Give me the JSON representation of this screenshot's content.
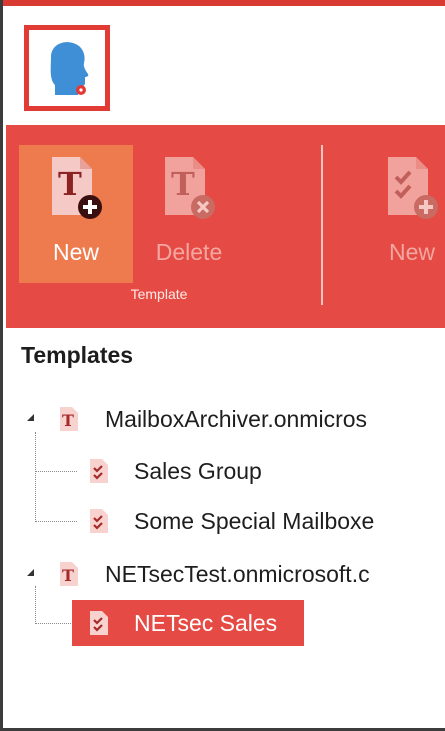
{
  "colors": {
    "ribbon": "#e54b44",
    "ribbon_active": "#ee7b4e",
    "selection": "#e54b44",
    "logo_border": "#e23a34",
    "logo_head": "#3f8fd7"
  },
  "ribbon": {
    "buttons": [
      {
        "label": "New",
        "icon": "template-new-icon",
        "state": "active"
      },
      {
        "label": "Delete",
        "icon": "template-delete-icon",
        "state": "disabled"
      },
      {
        "label": "New",
        "icon": "checklist-new-icon",
        "state": "disabled"
      }
    ],
    "group_label": "Template"
  },
  "tree": {
    "title": "Templates",
    "nodes": [
      {
        "label": "MailboxArchiver.onmicros",
        "icon": "template-t-icon",
        "level": 0,
        "expanded": true
      },
      {
        "label": "Sales Group",
        "icon": "checklist-doc-icon",
        "level": 1
      },
      {
        "label": "Some Special Mailboxe",
        "icon": "checklist-doc-icon",
        "level": 1
      },
      {
        "label": "NETsecTest.onmicrosoft.c",
        "icon": "template-t-icon",
        "level": 0,
        "expanded": true
      },
      {
        "label": "NETsec Sales",
        "icon": "checklist-doc-icon",
        "level": 1,
        "selected": true
      }
    ]
  }
}
